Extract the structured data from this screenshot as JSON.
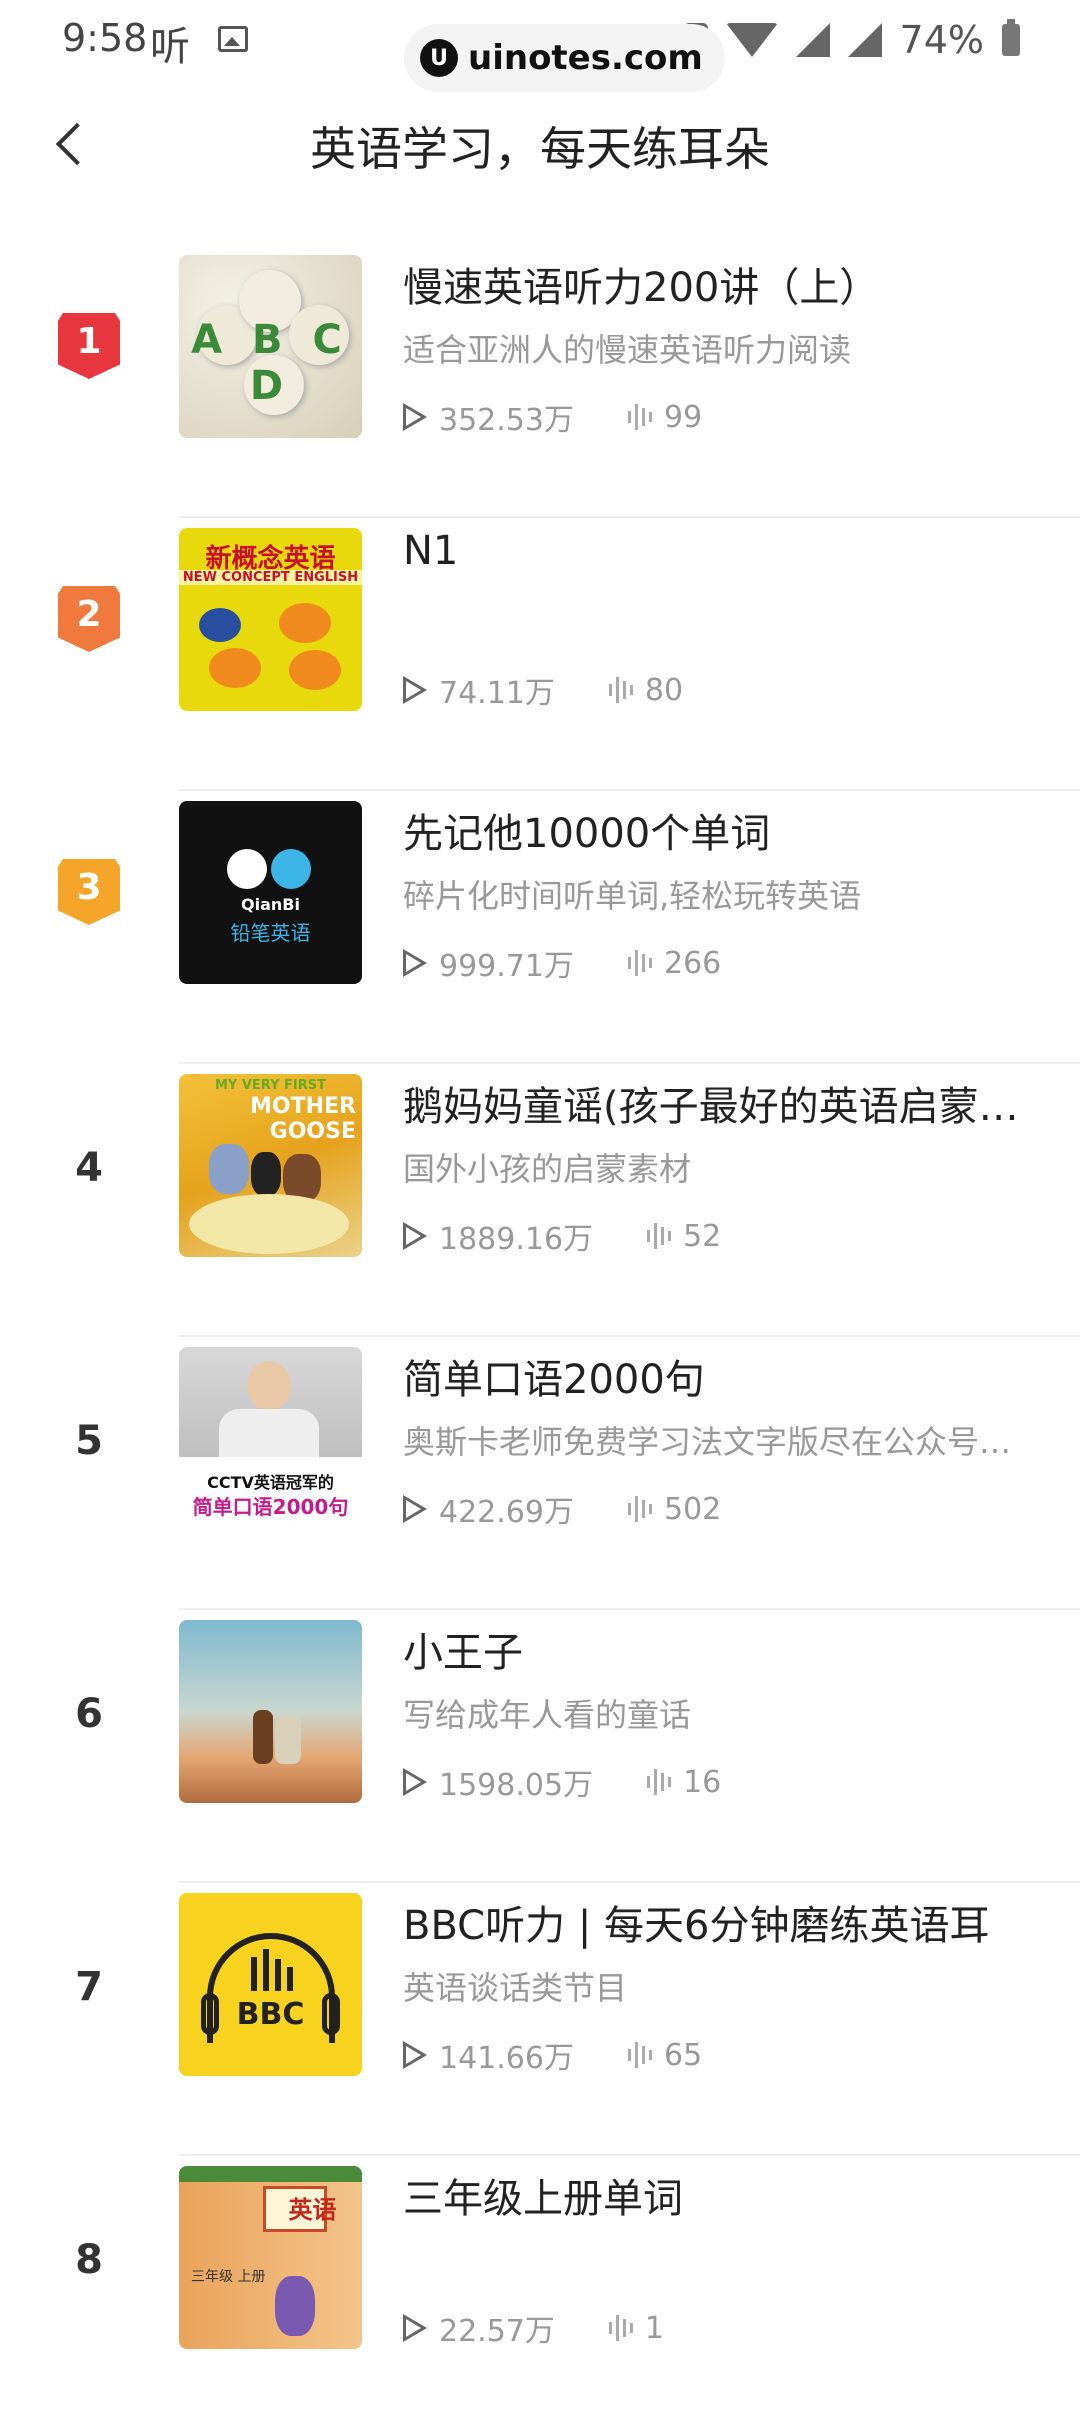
{
  "status_bar": {
    "time": "9:58",
    "app_glyph": "听",
    "battery": "74%"
  },
  "watermark": {
    "text": "uinotes.com"
  },
  "header": {
    "title": "英语学习，每天练耳朵"
  },
  "colors": {
    "rank1": "#e8363f",
    "rank2": "#f07a3e",
    "rank3": "#f4a52a"
  },
  "items": [
    {
      "rank": "1",
      "name": "慢速英语听力200讲（上）",
      "desc": "适合亚洲人的慢速英语听力阅读",
      "plays": "352.53万",
      "tracks": "99",
      "cover_text": "A B C D"
    },
    {
      "rank": "2",
      "name": "N1",
      "desc": "",
      "plays": "74.11万",
      "tracks": "80",
      "cover_text": "新概念英语",
      "cover_sub": "NEW CONCEPT ENGLISH"
    },
    {
      "rank": "3",
      "name": "先记他10000个单词",
      "desc": "碎片化时间听单词,轻松玩转英语",
      "plays": "999.71万",
      "tracks": "266",
      "cover_text": "铅笔英语",
      "cover_sub": "QianBi"
    },
    {
      "rank": "4",
      "name": "鹅妈妈童谣(孩子最好的英语启蒙…",
      "desc": "国外小孩的启蒙素材",
      "plays": "1889.16万",
      "tracks": "52",
      "cover_text": "MOTHER GOOSE",
      "cover_sub": "MY VERY FIRST"
    },
    {
      "rank": "5",
      "name": "简单口语2000句",
      "desc": "奥斯卡老师免费学习法文字版尽在公众号…",
      "plays": "422.69万",
      "tracks": "502",
      "cover_text": "简单口语2000句",
      "cover_sub": "CCTV英语冠军的"
    },
    {
      "rank": "6",
      "name": "小王子",
      "desc": "写给成年人看的童话",
      "plays": "1598.05万",
      "tracks": "16",
      "cover_text": ""
    },
    {
      "rank": "7",
      "name": "BBC听力 | 每天6分钟磨练英语耳",
      "desc": "英语谈话类节目",
      "plays": "141.66万",
      "tracks": "65",
      "cover_text": "BBC"
    },
    {
      "rank": "8",
      "name": "三年级上册单词",
      "desc": "",
      "plays": "22.57万",
      "tracks": "1",
      "cover_text": "英语",
      "cover_sub": "三年级 上册"
    }
  ]
}
